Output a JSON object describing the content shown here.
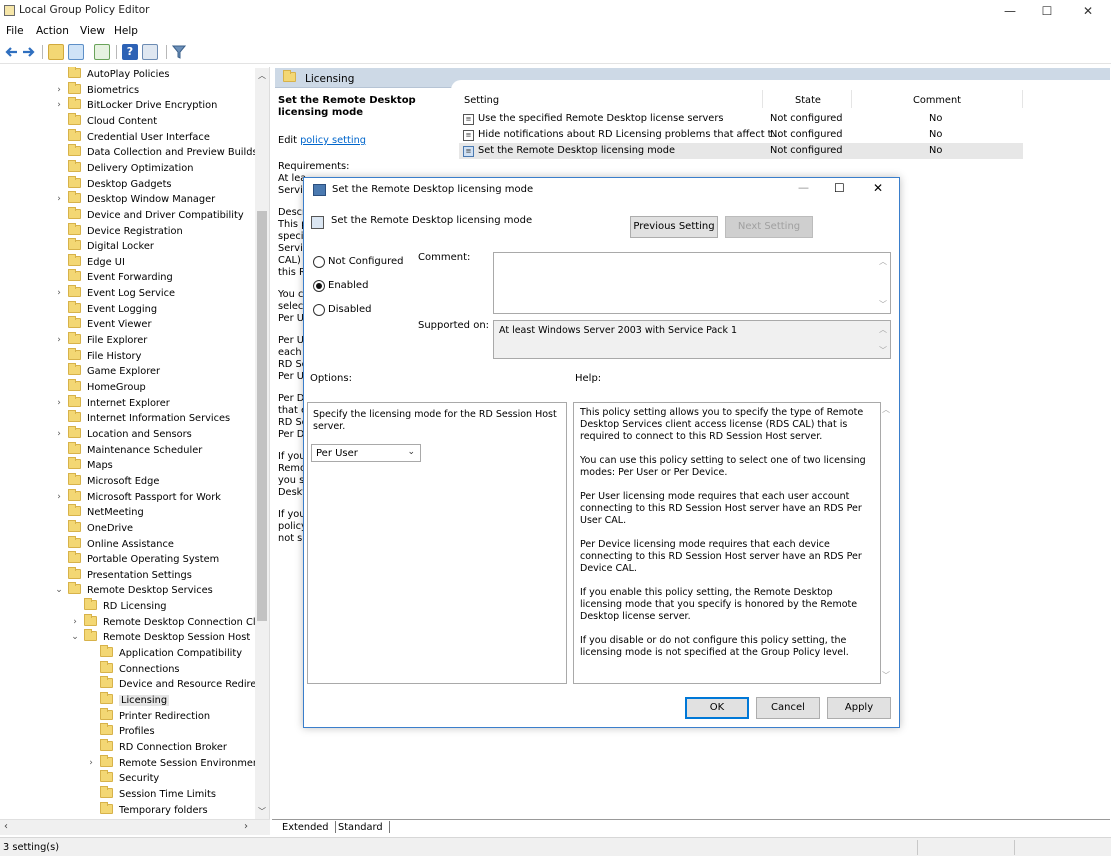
{
  "window": {
    "title": "Local Group Policy Editor",
    "minimize": "—",
    "maximize": "☐",
    "close": "✕"
  },
  "menu": [
    "File",
    "Action",
    "View",
    "Help"
  ],
  "tree": {
    "items": [
      {
        "label": "AutoPlay Policies",
        "depth": 0,
        "expander": ""
      },
      {
        "label": "Biometrics",
        "depth": 0,
        "expander": "›"
      },
      {
        "label": "BitLocker Drive Encryption",
        "depth": 0,
        "expander": "›"
      },
      {
        "label": "Cloud Content",
        "depth": 0,
        "expander": ""
      },
      {
        "label": "Credential User Interface",
        "depth": 0,
        "expander": ""
      },
      {
        "label": "Data Collection and Preview Builds",
        "depth": 0,
        "expander": ""
      },
      {
        "label": "Delivery Optimization",
        "depth": 0,
        "expander": ""
      },
      {
        "label": "Desktop Gadgets",
        "depth": 0,
        "expander": ""
      },
      {
        "label": "Desktop Window Manager",
        "depth": 0,
        "expander": "›"
      },
      {
        "label": "Device and Driver Compatibility",
        "depth": 0,
        "expander": ""
      },
      {
        "label": "Device Registration",
        "depth": 0,
        "expander": ""
      },
      {
        "label": "Digital Locker",
        "depth": 0,
        "expander": ""
      },
      {
        "label": "Edge UI",
        "depth": 0,
        "expander": ""
      },
      {
        "label": "Event Forwarding",
        "depth": 0,
        "expander": ""
      },
      {
        "label": "Event Log Service",
        "depth": 0,
        "expander": "›"
      },
      {
        "label": "Event Logging",
        "depth": 0,
        "expander": ""
      },
      {
        "label": "Event Viewer",
        "depth": 0,
        "expander": ""
      },
      {
        "label": "File Explorer",
        "depth": 0,
        "expander": "›"
      },
      {
        "label": "File History",
        "depth": 0,
        "expander": ""
      },
      {
        "label": "Game Explorer",
        "depth": 0,
        "expander": ""
      },
      {
        "label": "HomeGroup",
        "depth": 0,
        "expander": ""
      },
      {
        "label": "Internet Explorer",
        "depth": 0,
        "expander": "›"
      },
      {
        "label": "Internet Information Services",
        "depth": 0,
        "expander": ""
      },
      {
        "label": "Location and Sensors",
        "depth": 0,
        "expander": "›"
      },
      {
        "label": "Maintenance Scheduler",
        "depth": 0,
        "expander": ""
      },
      {
        "label": "Maps",
        "depth": 0,
        "expander": ""
      },
      {
        "label": "Microsoft Edge",
        "depth": 0,
        "expander": ""
      },
      {
        "label": "Microsoft Passport for Work",
        "depth": 0,
        "expander": "›"
      },
      {
        "label": "NetMeeting",
        "depth": 0,
        "expander": ""
      },
      {
        "label": "OneDrive",
        "depth": 0,
        "expander": ""
      },
      {
        "label": "Online Assistance",
        "depth": 0,
        "expander": ""
      },
      {
        "label": "Portable Operating System",
        "depth": 0,
        "expander": ""
      },
      {
        "label": "Presentation Settings",
        "depth": 0,
        "expander": ""
      },
      {
        "label": "Remote Desktop Services",
        "depth": 0,
        "expander": "⌄"
      },
      {
        "label": "RD Licensing",
        "depth": 1,
        "expander": ""
      },
      {
        "label": "Remote Desktop Connection Clie",
        "depth": 1,
        "expander": "›"
      },
      {
        "label": "Remote Desktop Session Host",
        "depth": 1,
        "expander": "⌄"
      },
      {
        "label": "Application Compatibility",
        "depth": 2,
        "expander": ""
      },
      {
        "label": "Connections",
        "depth": 2,
        "expander": ""
      },
      {
        "label": "Device and Resource Redirect",
        "depth": 2,
        "expander": ""
      },
      {
        "label": "Licensing",
        "depth": 2,
        "expander": "",
        "selected": true
      },
      {
        "label": "Printer Redirection",
        "depth": 2,
        "expander": ""
      },
      {
        "label": "Profiles",
        "depth": 2,
        "expander": ""
      },
      {
        "label": "RD Connection Broker",
        "depth": 2,
        "expander": ""
      },
      {
        "label": "Remote Session Environment",
        "depth": 2,
        "expander": "›"
      },
      {
        "label": "Security",
        "depth": 2,
        "expander": ""
      },
      {
        "label": "Session Time Limits",
        "depth": 2,
        "expander": ""
      },
      {
        "label": "Temporary folders",
        "depth": 2,
        "expander": ""
      }
    ]
  },
  "right": {
    "header": "Licensing",
    "desc": {
      "title": "Set the Remote Desktop licensing mode",
      "edit_prefix": "Edit ",
      "edit_link": "policy setting ",
      "requirements_label": "Requirements:",
      "fragments": [
        "At lea",
        "Servic",
        "Descr",
        "This p",
        "specif",
        "Servic",
        "CAL)",
        "this R",
        "You c",
        "select",
        "Per U",
        "Per U",
        "each",
        "RD Se",
        "Per U",
        "Per D",
        "that e",
        "RD Se",
        "Per D",
        "If you",
        "Remo",
        "you s",
        "Deskt",
        "If you",
        "policy",
        "not sp"
      ]
    },
    "columns": {
      "setting": "Setting",
      "state": "State",
      "comment": "Comment"
    },
    "rows": [
      {
        "setting": "Use the specified Remote Desktop license servers",
        "state": "Not configured",
        "comment": "No"
      },
      {
        "setting": "Hide notifications about RD Licensing problems that affect t...",
        "state": "Not configured",
        "comment": "No"
      },
      {
        "setting": "Set the Remote Desktop licensing mode",
        "state": "Not configured",
        "comment": "No"
      }
    ],
    "tabs": [
      "Extended",
      "Standard"
    ]
  },
  "status": "3 setting(s)",
  "dialog": {
    "title": "Set the Remote Desktop licensing mode",
    "header_setting": "Set the Remote Desktop licensing mode",
    "previous": "Previous Setting",
    "next": "Next Setting",
    "radio_not_configured": "Not Configured",
    "radio_enabled": "Enabled",
    "radio_disabled": "Disabled",
    "comment_label": "Comment:",
    "comment_value": "",
    "supported_label": "Supported on:",
    "supported_value": "At least Windows Server 2003 with Service Pack 1",
    "options_label": "Options:",
    "help_label": "Help:",
    "options_text": "Specify the licensing mode for the RD Session Host server.",
    "mode_selected": "Per User",
    "help": [
      "This policy setting allows you to specify the type of Remote Desktop Services client access license (RDS CAL) that is required to connect to this RD Session Host server.",
      "You can use this policy setting to select one of two licensing modes: Per User or Per Device.",
      "Per User licensing mode requires that each user account connecting to this RD Session Host server have an RDS Per User CAL.",
      "Per Device licensing mode requires that each device connecting to this RD Session Host server have an RDS Per Device CAL.",
      "If you enable this policy setting, the Remote Desktop licensing mode that you specify is honored by the Remote Desktop license server.",
      "If you disable or do not configure this policy setting, the licensing mode is not specified at the Group Policy level."
    ],
    "ok": "OK",
    "cancel": "Cancel",
    "apply": "Apply"
  }
}
